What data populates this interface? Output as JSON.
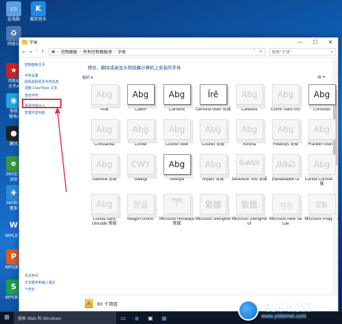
{
  "desktop": {
    "icons": [
      {
        "label": "此电脑",
        "color": "#5aa0e8",
        "glyph": "▭"
      },
      {
        "label": "酷狗音乐",
        "color": "#1e88e5",
        "glyph": "K"
      },
      {
        "label": "回收站",
        "color": "#4a78b5",
        "glyph": "♻"
      },
      {
        "label": "河南省\n大学A",
        "color": "#c22",
        "glyph": "★"
      },
      {
        "label": "系统\n锐电I",
        "color": "#2aa0e0",
        "glyph": "◉"
      },
      {
        "label": "腾讯",
        "color": "#222",
        "glyph": "●"
      },
      {
        "label": "360安全\n浏览",
        "color": "#3a9a3a",
        "glyph": "e"
      },
      {
        "label": "360软件\n管家",
        "color": "#2a8cd0",
        "glyph": "◈"
      },
      {
        "label": "WPS文字",
        "color": "#2166d6",
        "glyph": "W"
      },
      {
        "label": "WPS演示",
        "color": "#e05a1e",
        "glyph": "P"
      },
      {
        "label": "WPS表格",
        "color": "#1e9e4a",
        "glyph": "S"
      }
    ]
  },
  "window": {
    "title": "字体",
    "breadcrumb": [
      "控制面板",
      "所有控制面板项",
      "字体"
    ],
    "search_placeholder": "搜索\"字体\"",
    "left_links": [
      {
        "label": "控制面板主页",
        "kind": "link"
      },
      {
        "label": "字体设置",
        "kind": "link"
      },
      {
        "label": "联机获取更多字体信息",
        "kind": "link"
      },
      {
        "label": "调整 ClearType 文本",
        "kind": "link"
      },
      {
        "label": "查找字符",
        "kind": "link"
      },
      {
        "label": "更改字体大小",
        "kind": "link"
      },
      {
        "label": "管理可选功能",
        "kind": "link"
      }
    ],
    "see_also": {
      "title": "另请参阅",
      "links": [
        "文本服务和输入语言",
        "个性化"
      ]
    },
    "heading": "预览、删除或者显示和隐藏计算机上安装的字体",
    "organize": "组织 ▾",
    "fonts": [
      {
        "name": "Arial",
        "sample": "Abg",
        "style": "light"
      },
      {
        "name": "Calibri",
        "sample": "Abg",
        "style": "dark"
      },
      {
        "name": "Cambria",
        "sample": "Abg",
        "style": "dark"
      },
      {
        "name": "Cambria Math 常规",
        "sample": "Ïrě",
        "style": "dark"
      },
      {
        "name": "Candara",
        "sample": "Abg",
        "style": "light"
      },
      {
        "name": "Comic Sans MS",
        "sample": "Abg",
        "style": "light"
      },
      {
        "name": "Consolas",
        "sample": "Abg",
        "style": "dark"
      },
      {
        "name": "Constantia",
        "sample": "Abg",
        "style": "light"
      },
      {
        "name": "Corbel",
        "sample": "Abg",
        "style": "light"
      },
      {
        "name": "Courier New",
        "sample": "Abg",
        "style": "light"
      },
      {
        "name": "Courier 常规",
        "sample": "Abg",
        "style": "light"
      },
      {
        "name": "Ebrima",
        "sample": "Abg",
        "style": "light"
      },
      {
        "name": "Fixedsys 常规",
        "sample": "Abg",
        "style": "light"
      },
      {
        "name": "Franklin Gothic",
        "sample": "Abg",
        "style": "light"
      },
      {
        "name": "Gabriola 常规",
        "sample": "Abg",
        "style": "light"
      },
      {
        "name": "Gadugi",
        "sample": "CWY",
        "style": "light"
      },
      {
        "name": "Georgia",
        "sample": "Abg",
        "style": "dark"
      },
      {
        "name": "Impact 常规",
        "sample": "Abg",
        "style": "light"
      },
      {
        "name": "Javanese Text 常规",
        "sample": "ꦄꦧ",
        "style": "light"
      },
      {
        "name": "Leelawadee UI",
        "sample": "ᎯᎯᏍ",
        "style": "light"
      },
      {
        "name": "Lucida Console 常规",
        "sample": "Abg",
        "style": "light"
      },
      {
        "name": "Lucida Sans Unicode 常规",
        "sample": "Abg",
        "style": "light"
      },
      {
        "name": "Malgun Gothic",
        "sample": "한글",
        "style": "light"
      },
      {
        "name": "Microsoft Himalaya 常规",
        "sample": "ཀཁ",
        "style": "light"
      },
      {
        "name": "Microsoft JhengHei",
        "sample": "繁體",
        "style": "light"
      },
      {
        "name": "Microsoft JhengHei UI",
        "sample": "繁體",
        "style": "light"
      },
      {
        "name": "Microsoft New Tai Lue",
        "sample": "ᦀᦁ",
        "style": "light"
      },
      {
        "name": "Microsoft PhagsPa",
        "sample": "ꡀꡁ",
        "style": "light"
      }
    ],
    "status_count": "83 个项目"
  },
  "taskbar": {
    "search_text": "搜索 Web 和 Windows"
  },
  "watermark": {
    "title": "纯净系统家园",
    "url": "www.yidaimei.com"
  }
}
